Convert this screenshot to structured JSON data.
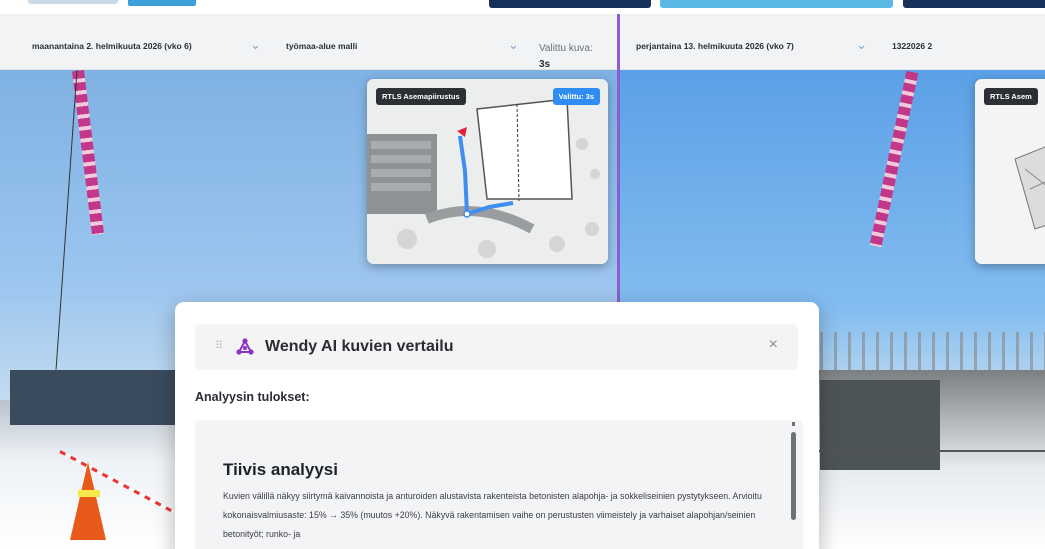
{
  "selectors": {
    "left_date": "maanantaina 2. helmikuuta 2026 (vko 6)",
    "left_model": "työmaa-alue malli",
    "selected_label": "Valittu kuva:",
    "selected_value": "3s",
    "right_date": "perjantaina 13. helmikuuta 2026 (vko 7)",
    "right_model": "1322026 2"
  },
  "map_left": {
    "title": "RTLS Asemapiirustus",
    "badge": "Valittu: 3s"
  },
  "map_right": {
    "title": "RTLS Asem"
  },
  "dialog": {
    "title": "Wendy AI kuvien vertailu",
    "close": "×",
    "drag_handle": "⠿",
    "results_label": "Analyysin tulokset:",
    "heading": "Tiivis analyysi",
    "text": "Kuvien välillä näkyy siirtymä kaivannoista ja anturoiden alustavista rakenteista betonisten alapohja- ja sokkeliseinien pystytykseen. Arvioitu kokonaisvalmiusaste: 15% → 35% (muutos +20%). Näkyvä rakentamisen vaihe on perustusten viimeistely ja varhaiset alapohjan/seinien betonityöt; runko- ja"
  },
  "colors": {
    "divider": "#8b5fd1",
    "accent": "#2f8cf0",
    "nav_dark": "#17325a",
    "nav_light": "#5cb8e4"
  },
  "icons": {
    "chevron": "chevron-down-icon",
    "ai": "ai-network-icon",
    "close": "close-icon",
    "drag": "drag-handle-icon"
  }
}
